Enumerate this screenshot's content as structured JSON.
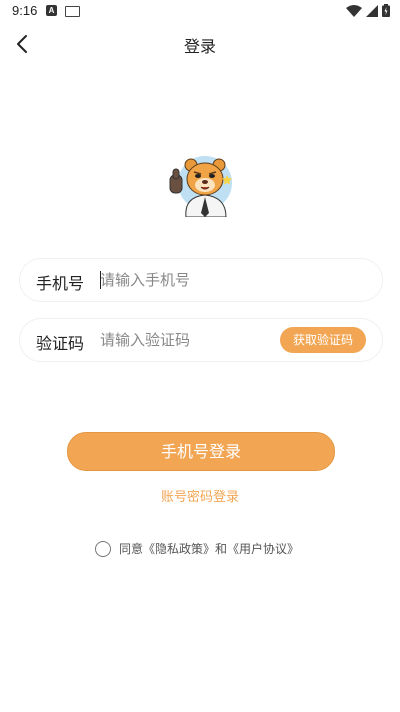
{
  "status_bar": {
    "time": "9:16",
    "a_badge": "A"
  },
  "header": {
    "title": "登录"
  },
  "phone_row": {
    "label": "手机号",
    "placeholder": "请输入手机号"
  },
  "code_row": {
    "label": "验证码",
    "placeholder": "请输入验证码",
    "button": "获取验证码"
  },
  "login_button": "手机号登录",
  "password_login_link": "账号密码登录",
  "agreement": {
    "prefix": "同意",
    "privacy": "《隐私政策》",
    "and": "和",
    "user": "《用户协议》"
  },
  "colors": {
    "accent": "#f2a654"
  },
  "icons": [
    "back-arrow-icon",
    "wifi-icon",
    "signal-icon",
    "battery-icon",
    "mascot-avatar"
  ]
}
